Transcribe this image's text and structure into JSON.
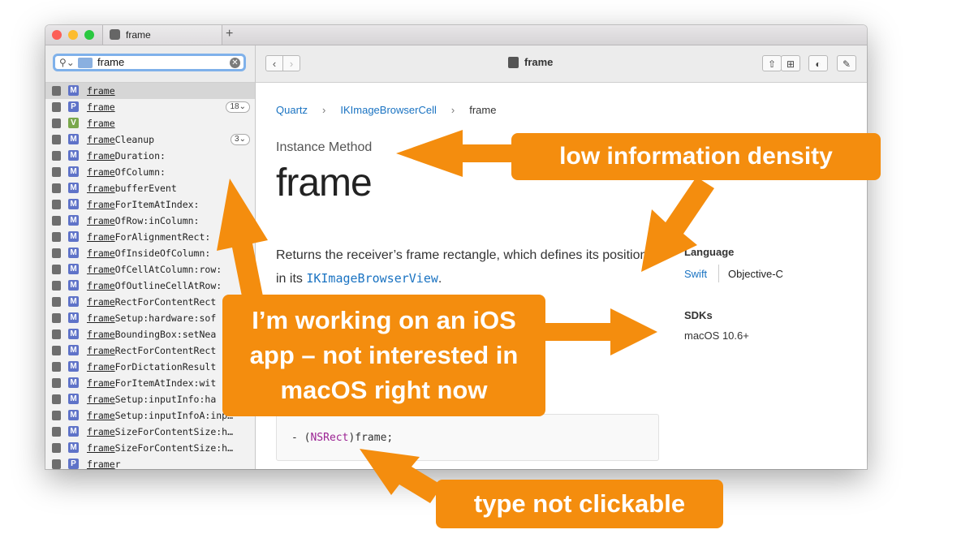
{
  "window": {
    "traffic_lights": [
      "#fc5f57",
      "#fdbc2e",
      "#2ac840"
    ],
    "tab_title": "frame",
    "new_tab": "+"
  },
  "sidebar": {
    "search": {
      "query": "frame",
      "clear": "✕",
      "search_icon": "magnifier-icon"
    },
    "results": [
      {
        "badge": "M",
        "match": "frame",
        "rest": "",
        "selected": true
      },
      {
        "badge": "P",
        "match": "frame",
        "rest": "",
        "count": "18⌄"
      },
      {
        "badge": "V",
        "match": "frame",
        "rest": ""
      },
      {
        "badge": "M",
        "match": "frame",
        "rest": "Cleanup",
        "count": "3⌄"
      },
      {
        "badge": "M",
        "match": "frame",
        "rest": "Duration:"
      },
      {
        "badge": "M",
        "match": "frame",
        "rest": "OfColumn:"
      },
      {
        "badge": "M",
        "match": "frame",
        "rest": "bufferEvent"
      },
      {
        "badge": "M",
        "match": "frame",
        "rest": "ForItemAtIndex:"
      },
      {
        "badge": "M",
        "match": "frame",
        "rest": "OfRow:inColumn:"
      },
      {
        "badge": "M",
        "match": "frame",
        "rest": "ForAlignmentRect:"
      },
      {
        "badge": "M",
        "match": "frame",
        "rest": "OfInsideOfColumn:"
      },
      {
        "badge": "M",
        "match": "frame",
        "rest": "OfCellAtColumn:row:"
      },
      {
        "badge": "M",
        "match": "frame",
        "rest": "OfOutlineCellAtRow:"
      },
      {
        "badge": "M",
        "match": "frame",
        "rest": "RectForContentRect"
      },
      {
        "badge": "M",
        "match": "frame",
        "rest": "Setup:hardware:sof"
      },
      {
        "badge": "M",
        "match": "frame",
        "rest": "BoundingBox:setNea"
      },
      {
        "badge": "M",
        "match": "frame",
        "rest": "RectForContentRect"
      },
      {
        "badge": "M",
        "match": "frame",
        "rest": "ForDictationResult"
      },
      {
        "badge": "M",
        "match": "frame",
        "rest": "ForItemAtIndex:wit"
      },
      {
        "badge": "M",
        "match": "frame",
        "rest": "Setup:inputInfo:ha"
      },
      {
        "badge": "M",
        "match": "frame",
        "rest": "Setup:inputInfoA:inp…"
      },
      {
        "badge": "M",
        "match": "frame",
        "rest": "SizeForContentSize:h…"
      },
      {
        "badge": "M",
        "match": "frame",
        "rest": "SizeForContentSize:h…"
      },
      {
        "badge": "P",
        "match": "frame",
        "rest": "r"
      }
    ],
    "badge_colors": {
      "M": "#5f73c8",
      "P": "#5f73c8",
      "V": "#7aa84c"
    }
  },
  "toolbar": {
    "back": "‹",
    "forward": "›",
    "title": "frame",
    "icons": [
      "share-icon",
      "bookmarks-icon",
      "appearance-icon",
      "annotate-icon"
    ]
  },
  "doc": {
    "breadcrumb": [
      "Quartz",
      "IKImageBrowserCell",
      "frame"
    ],
    "breadcrumb_sep": "›",
    "kind": "Instance Method",
    "title": "frame",
    "desc_before": "Returns the receiver’s frame rectangle, which defines its position in its ",
    "desc_code": "IKImageBrowserView",
    "desc_after": ".",
    "language_heading": "Language",
    "languages": [
      "Swift",
      "Objective-C"
    ],
    "sdks_heading": "SDKs",
    "sdk": "macOS 10.6+",
    "declaration_prefix": "- (",
    "declaration_type": "NSRect",
    "declaration_suffix": ")frame;"
  },
  "annotations": {
    "density": "low information density",
    "ios_line1": "I’m working on an iOS",
    "ios_line2": "app – not interested in",
    "ios_line3": "macOS right now",
    "type": "type not clickable",
    "color": "#f48d0e"
  }
}
